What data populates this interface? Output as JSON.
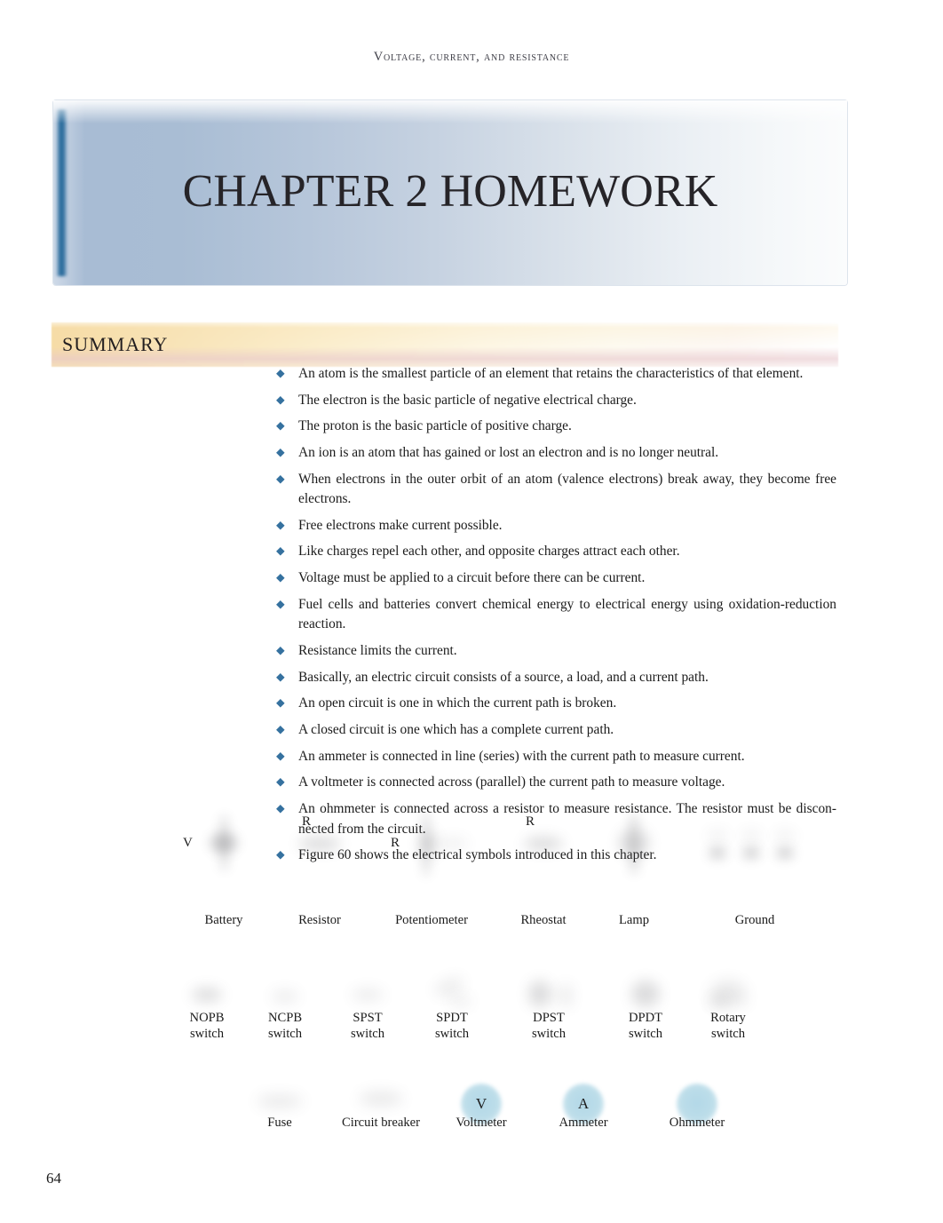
{
  "running_head": "Voltage, Current, and Resistance",
  "chapter": {
    "title": "CHAPTER 2 HOMEWORK"
  },
  "summary": {
    "heading": "SUMMARY",
    "bullet_glyph": "◆",
    "bullet_color": "#35719f",
    "items": [
      "An atom is the smallest particle of an element that retains the characteristics of that element.",
      "The electron is the basic particle of negative electrical charge.",
      "The proton is the basic particle of positive charge.",
      "An ion is an atom that has gained or lost an electron and is no longer neutral.",
      "When electrons in the outer orbit of an atom (valence electrons) break away, they become free electrons.",
      "Free electrons make current possible.",
      "Like charges repel each other, and opposite charges attract each other.",
      "Voltage must be applied to a circuit before there can be current.",
      "Fuel cells and batteries convert chemical energy to electrical energy using oxidation-reduction reaction.",
      "Resistance limits the current.",
      "Basically, an electric circuit consists of a source, a load, and a current path.",
      "An open circuit is one in which the current path is broken.",
      "A closed circuit is one which has a complete current path.",
      "An ammeter is connected in line (series) with the current path to measure current.",
      "A voltmeter is connected across (parallel) the current path to measure voltage.",
      "An ohmmeter is connected across a resistor to measure resistance. The resistor must be discon-nected from the circuit.",
      "Figure 60 shows the electrical symbols introduced in this chapter."
    ]
  },
  "figure": {
    "meter_fill_color": "#bcdde9",
    "rows": [
      {
        "symbols": [
          {
            "caption": "Battery",
            "side_label": "V",
            "icon": "battery-symbol"
          },
          {
            "caption": "Resistor",
            "top_label": "R",
            "icon": "resistor-symbol"
          },
          {
            "caption": "Potentiometer",
            "side_label": "R",
            "icon": "potentiometer-symbol"
          },
          {
            "caption": "Rheostat",
            "top_label": "R",
            "icon": "rheostat-symbol"
          },
          {
            "caption": "Lamp",
            "icon": "lamp-symbol"
          },
          {
            "caption": "Ground",
            "icon": "ground-symbol"
          }
        ]
      },
      {
        "symbols": [
          {
            "caption": "NOPB\nswitch",
            "icon": "nopb-switch-symbol"
          },
          {
            "caption": "NCPB\nswitch",
            "icon": "ncpb-switch-symbol"
          },
          {
            "caption": "SPST\nswitch",
            "icon": "spst-switch-symbol"
          },
          {
            "caption": "SPDT\nswitch",
            "icon": "spdt-switch-symbol"
          },
          {
            "caption": "DPST\nswitch",
            "icon": "dpst-switch-symbol"
          },
          {
            "caption": "DPDT\nswitch",
            "icon": "dpdt-switch-symbol"
          },
          {
            "caption": "Rotary\nswitch",
            "icon": "rotary-switch-symbol"
          }
        ]
      },
      {
        "symbols": [
          {
            "caption": "Fuse",
            "icon": "fuse-symbol"
          },
          {
            "caption": "Circuit breaker",
            "icon": "circuit-breaker-symbol"
          },
          {
            "caption": "Voltmeter",
            "meter_letter": "V",
            "icon": "voltmeter-symbol"
          },
          {
            "caption": "Ammeter",
            "meter_letter": "A",
            "icon": "ammeter-symbol"
          },
          {
            "caption": "Ohmmeter",
            "meter_letter": "",
            "icon": "ohmmeter-symbol"
          }
        ]
      }
    ]
  },
  "page_number": "64"
}
